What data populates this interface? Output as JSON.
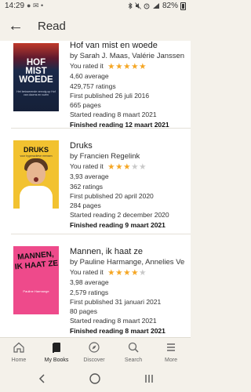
{
  "status_bar": {
    "time": "14:29",
    "battery_percent": "82%",
    "notification_icons": [
      "message-icon",
      "email-icon",
      "dot"
    ],
    "system_icons": [
      "bluetooth-icon",
      "mute-icon",
      "alarm-icon",
      "4g-icon",
      "signal-icon",
      "battery-icon"
    ]
  },
  "header": {
    "title": "Read"
  },
  "books": [
    {
      "title": "Hof van mist en woede",
      "author": "by Sarah J. Maas, Valérie Janssen",
      "rated_label": "You rated it",
      "user_rating": 5,
      "average": "4,60 average",
      "ratings": "429,757 ratings",
      "first_published": "First published 26 juli 2016",
      "pages": "665 pages",
      "started": "Started reading 8 maart 2021",
      "finished": "Finished reading 12 maart 2021",
      "cover": {
        "title_lines": [
          "HOF",
          "MIST",
          "WOEDE"
        ],
        "subtitle": "Het betoverende vervolg op Hof van doorns en rozen",
        "colors": [
          "#c0392b",
          "#1b2a4a"
        ]
      }
    },
    {
      "title": "Druks",
      "author": "by Francien Regelink",
      "rated_label": "You rated it",
      "user_rating": 3,
      "average": "3,93 average",
      "ratings": "362 ratings",
      "first_published": "First published 20 april 2020",
      "pages": "284 pages",
      "started": "Started reading 2 december 2020",
      "finished": "Finished reading 9 maart 2021",
      "cover": {
        "title_lines": [
          "DRUKS"
        ],
        "subtitle": "voor hyperactieve mensen",
        "colors": [
          "#f2c230"
        ]
      }
    },
    {
      "title": "Mannen, ik haat ze",
      "author": "by Pauline Harmange, Annelies Ve",
      "rated_label": "You rated it",
      "user_rating": 4,
      "average": "3,98 average",
      "ratings": "2,579 ratings",
      "first_published": "First published 31 januari 2021",
      "pages": "80 pages",
      "started": "Started reading 8 maart 2021",
      "finished": "Finished reading 8 maart 2021",
      "cover": {
        "title_lines": [
          "MANNEN,",
          "IK HAAT ZE"
        ],
        "subtitle": "Pauline Harmange",
        "colors": [
          "#ee4a8b"
        ]
      }
    }
  ],
  "bottom_nav": [
    {
      "label": "Home",
      "icon": "home-icon",
      "active": false
    },
    {
      "label": "My Books",
      "icon": "book-icon",
      "active": true
    },
    {
      "label": "Discover",
      "icon": "compass-icon",
      "active": false
    },
    {
      "label": "Search",
      "icon": "search-icon",
      "active": false
    },
    {
      "label": "More",
      "icon": "menu-icon",
      "active": false
    }
  ],
  "system_nav": [
    "back-chevron-icon",
    "home-circle-icon",
    "recents-icon"
  ],
  "colors": {
    "star_on": "#f5a623",
    "star_off": "#c9c9c9",
    "background": "#f4f1ea"
  }
}
